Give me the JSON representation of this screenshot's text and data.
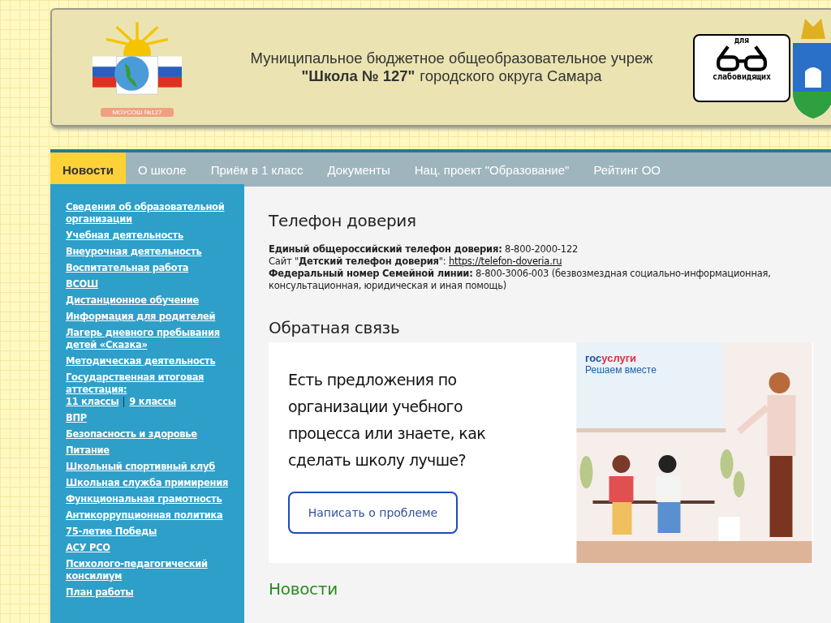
{
  "header": {
    "title_line1": "Муниципальное бюджетное общеобразовательное учреж",
    "title_line2_bold": "\"Школа № 127\"",
    "title_line2_rest": "городского округа Самара",
    "logo_caption": "МОУСОШ №127",
    "accessibility": {
      "top": "для",
      "bottom": "слабовидящих"
    }
  },
  "nav": [
    {
      "label": "Новости",
      "selected": true
    },
    {
      "label": "О школе",
      "selected": false
    },
    {
      "label": "Приём в 1 класс",
      "selected": false
    },
    {
      "label": "Документы",
      "selected": false
    },
    {
      "label": "Нац. проект \"Образование\"",
      "selected": false
    },
    {
      "label": "Рейтинг ОО",
      "selected": false
    }
  ],
  "sidebar": [
    {
      "label": "Сведения об образовательной организации"
    },
    {
      "label": "Учебная деятельность"
    },
    {
      "label": "Внеурочная деятельность"
    },
    {
      "label": "Воспитательная работа"
    },
    {
      "label": "ВСОШ"
    },
    {
      "label": "Дистанционное обучение"
    },
    {
      "label": "Информация для родителей"
    },
    {
      "label": "Лагерь дневного пребывания детей «Сказка»"
    },
    {
      "label": "Методическая деятельность"
    },
    {
      "label": "Государственная итоговая аттестация:",
      "links": [
        "11 классы",
        "9 классы"
      ]
    },
    {
      "label": "ВПР"
    },
    {
      "label": "Безопасность и здоровье"
    },
    {
      "label": "Питание"
    },
    {
      "label": "Школьный спортивный клуб"
    },
    {
      "label": "Школьная служба примирения"
    },
    {
      "label": "Функциональная грамотность"
    },
    {
      "label": "Антикоррупционная политика"
    },
    {
      "label": "75-летие Победы"
    },
    {
      "label": "АСУ РСО"
    },
    {
      "label": "Психолого-педагогический консилиум"
    },
    {
      "label": "План работы"
    }
  ],
  "hotline": {
    "title": "Телефон доверия",
    "line1": "**Единый общероссийский телефон доверия:** 8-800-2000-122",
    "line2": "Сайт \"**Детский телефон доверия**\":",
    "line2_link": "https://telefon-doveria.ru",
    "line3": "**Федеральный номер Семейной линии:** 8-800-3006-003 (безвозмездная социально-информационная, консультационная, юридическая и иная помощь)"
  },
  "feedback": {
    "title": "Обратная связь",
    "question": "Есть предложения по организации учебного процесса или знаете, как сделать школу лучше?",
    "button": "Написать о проблеме",
    "logo": [
      "гос",
      "услуги"
    ],
    "slogan": "Решаем вместе"
  },
  "news": {
    "title": "Новости"
  }
}
